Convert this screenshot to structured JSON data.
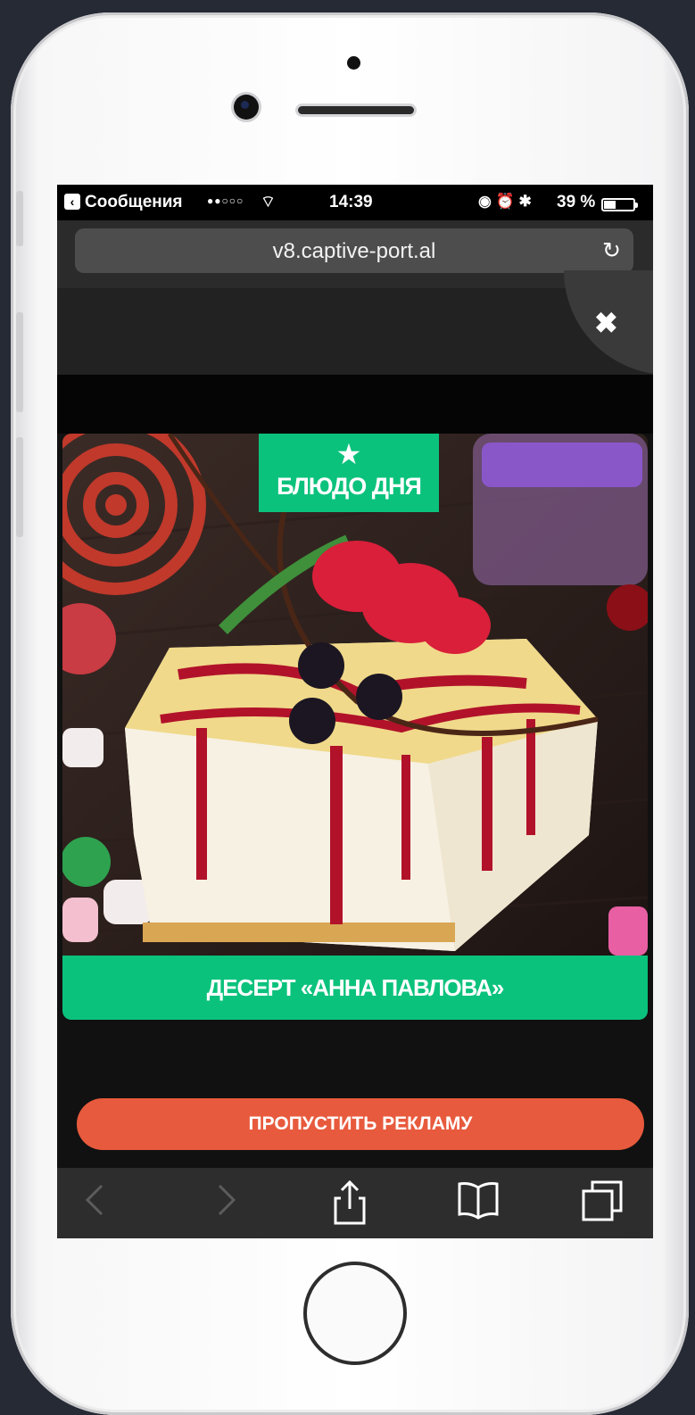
{
  "status_bar": {
    "back_app": "Сообщения",
    "signal": "●●○○○",
    "time": "14:39",
    "battery_percent": "39 %"
  },
  "browser": {
    "url": "v8.captive-port.al"
  },
  "ad": {
    "badge_label": "БЛЮДО ДНЯ",
    "caption": "ДЕСЕРТ «АННА ПАВЛОВА»",
    "skip_label": "ПРОПУСТИТЬ РЕКЛАМУ"
  },
  "colors": {
    "accent_green": "#0bc27c",
    "skip_button": "#e85a3d"
  },
  "icons": [
    "back-icon",
    "wifi-icon",
    "battery-icon",
    "reload-icon",
    "close-icon",
    "star-icon",
    "back-arrow-icon",
    "forward-arrow-icon",
    "share-icon",
    "bookmarks-icon",
    "tabs-icon"
  ]
}
